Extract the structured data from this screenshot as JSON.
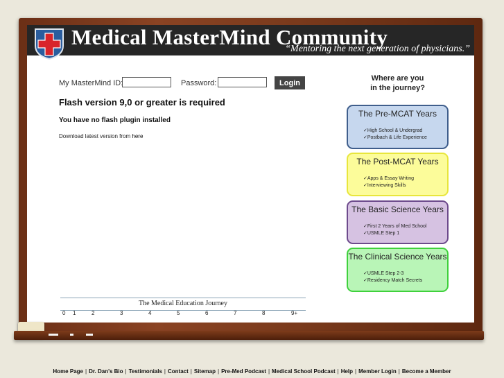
{
  "header": {
    "title": "Medical MasterMind Community",
    "tagline": "“Mentoring the next generation of physicians.”"
  },
  "login": {
    "id_label": "My MasterMind ID:",
    "password_label": "Password:",
    "id_value": "",
    "password_value": "",
    "button_label": "Login"
  },
  "flash": {
    "heading": "Flash version 9,0 or greater is required",
    "subheading": "You have no flash plugin installed",
    "download_text": "Download latest version from ",
    "download_link": "here"
  },
  "journey": {
    "question_line1": "Where are you",
    "question_line2": "in the journey?",
    "cards": [
      {
        "title": "The Pre-MCAT Years",
        "items": [
          "High School & Undergrad",
          "Postbach & Life Experience"
        ],
        "fill": "#c6d7ee",
        "border": "#3f5e8c"
      },
      {
        "title": "The Post-MCAT Years",
        "items": [
          "Apps & Essay Writing",
          "Interviewing Skills"
        ],
        "fill": "#fcfc9a",
        "border": "#e8e63c"
      },
      {
        "title": "The Basic Science Years",
        "items": [
          "First 2 Years of Med School",
          "USMLE Step 1"
        ],
        "fill": "#d6c2e2",
        "border": "#6d4a8c"
      },
      {
        "title": "The Clinical Science Years",
        "items": [
          "USMLE Step 2-3",
          "Residency Match Secrets"
        ],
        "fill": "#b9f5b7",
        "border": "#3fd13c"
      }
    ]
  },
  "timeline": {
    "title": "The Medical Education Journey",
    "ticks": [
      "0",
      "1",
      "2",
      "3",
      "4",
      "5",
      "6",
      "7",
      "8",
      "9+"
    ]
  },
  "footer": {
    "links": [
      "Home Page",
      "Dr. Dan's Bio",
      "Testimonials",
      "Contact",
      "Sitemap",
      "Pre-Med Podcast",
      "Medical School Podcast",
      "Help",
      "Member Login",
      "Become a Member"
    ],
    "separator": "|"
  }
}
